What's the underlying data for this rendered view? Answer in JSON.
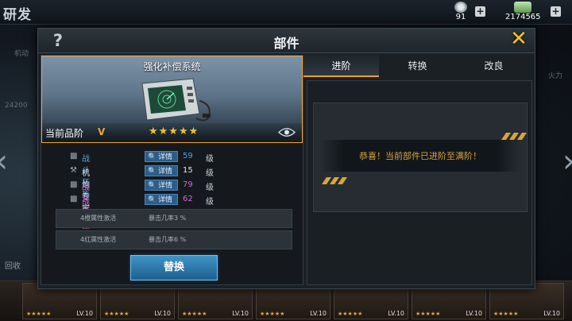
{
  "background": {
    "title": "研发",
    "medals": "91",
    "cash": "2174565",
    "faint_texts": [
      "机动",
      "24200",
      "火力"
    ],
    "weapon_levels": [
      "LV.10",
      "LV.10",
      "LV.10",
      "LV.10",
      "LV.10",
      "LV.10",
      "LV.10",
      "LV.10"
    ],
    "recycle_label": "回收"
  },
  "modal": {
    "title": "部件",
    "help_symbol": "?",
    "close_symbol": "✕"
  },
  "part": {
    "name": "强化补偿系统",
    "quality_label": "当前品阶",
    "quality_grade": "V",
    "stars": "★★★★★"
  },
  "skills": [
    {
      "name": "战斗狂热",
      "detail": "详情",
      "value": "59",
      "unit": "级",
      "color": "#4fa3e6"
    },
    {
      "name": "机炮专家",
      "detail": "详情",
      "value": "15",
      "unit": "级",
      "color": "#dfe6ea"
    },
    {
      "name": "战斗狂热",
      "detail": "详情",
      "value": "79",
      "unit": "级",
      "color": "#c86ad6"
    },
    {
      "name": "战斗狂热",
      "detail": "详情",
      "value": "62",
      "unit": "级",
      "color": "#c86ad6"
    }
  ],
  "attributes": [
    {
      "label": "4橙属性激活",
      "value": "暴击几率3 %"
    },
    {
      "label": "4红属性激活",
      "value": "暴击几率6 %"
    }
  ],
  "replace_button": "替换",
  "tabs": [
    "进阶",
    "转换",
    "改良"
  ],
  "message": "恭喜！当前部件已进阶至满阶！",
  "colors": {
    "accent": "#f0a43a",
    "button": "#2e7fb4",
    "message": "#d8a33e"
  }
}
